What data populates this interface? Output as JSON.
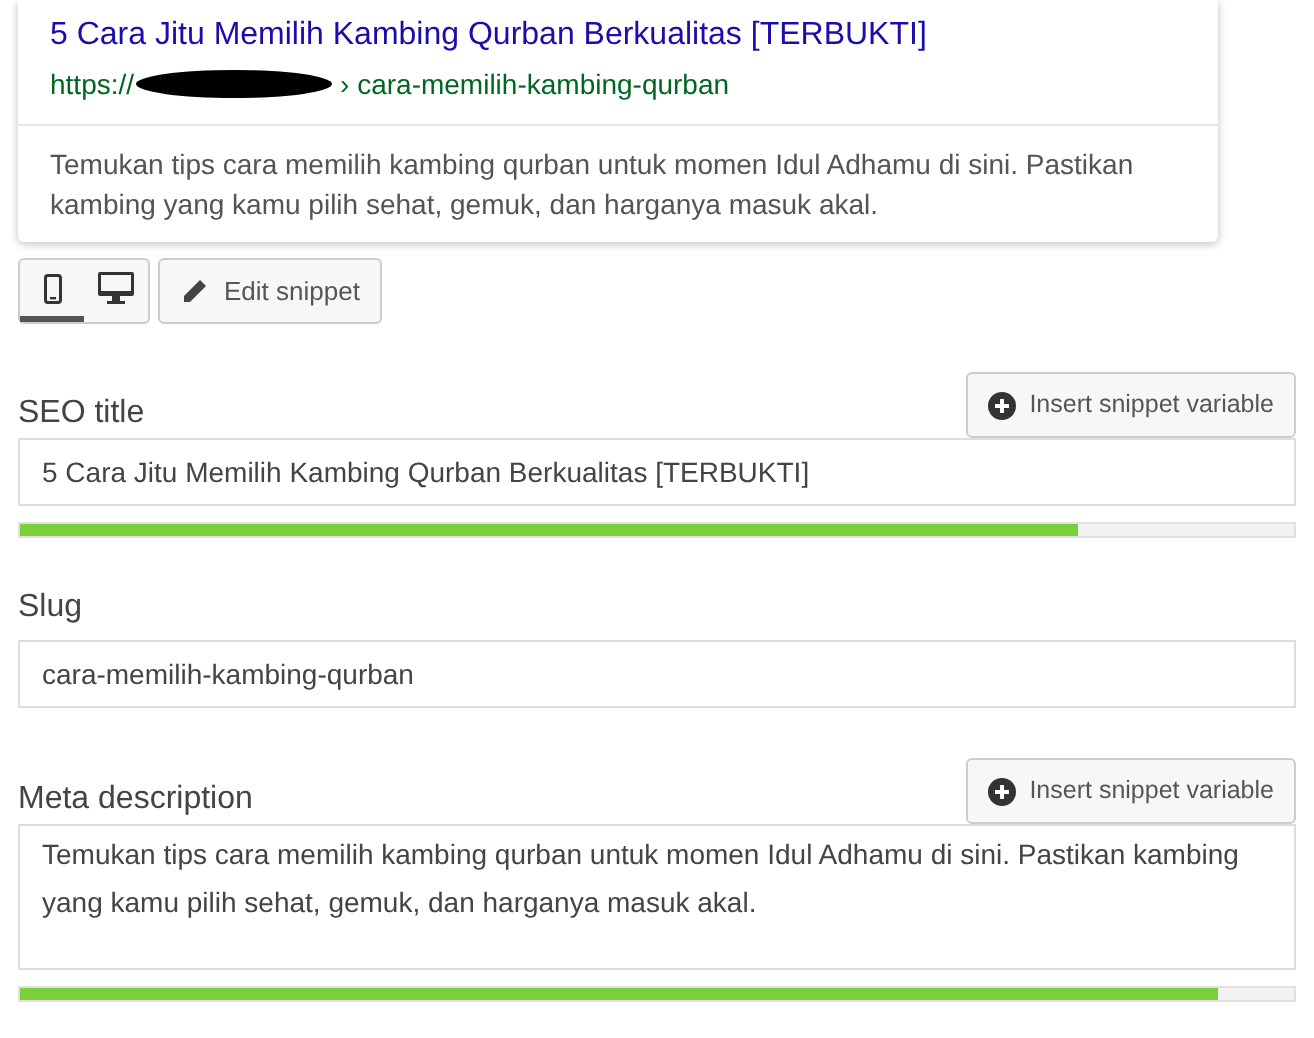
{
  "preview": {
    "title": "5 Cara Jitu Memilih Kambing Qurban Berkualitas [TERBUKTI]",
    "url_prefix": "https://",
    "url_path": "› cara-memilih-kambing-qurban",
    "description": "Temukan tips cara memilih kambing qurban untuk momen Idul Adhamu di sini. Pastikan kambing yang kamu pilih sehat, gemuk, dan harganya masuk akal."
  },
  "devices": [
    {
      "kind": "mobile",
      "selected": true
    },
    {
      "kind": "desktop",
      "selected": false
    }
  ],
  "edit_button": "Edit snippet",
  "fields": [
    {
      "kind": "input",
      "label": "SEO title",
      "button": "Insert snippet variable",
      "value": "5 Cara Jitu Memilih Kambing Qurban Berkualitas [TERBUKTI]",
      "level": 0.83
    },
    {
      "kind": "input",
      "label": "Slug",
      "value": "cara-memilih-kambing-qurban"
    },
    {
      "kind": "textarea",
      "label": "Meta description",
      "button": "Insert snippet variable",
      "value": "Temukan tips cara memilih kambing qurban untuk momen Idul Adhamu di sini. Pastikan kambing yang kamu pilih sehat, gemuk, dan harganya masuk akal.",
      "level": 0.94
    }
  ]
}
